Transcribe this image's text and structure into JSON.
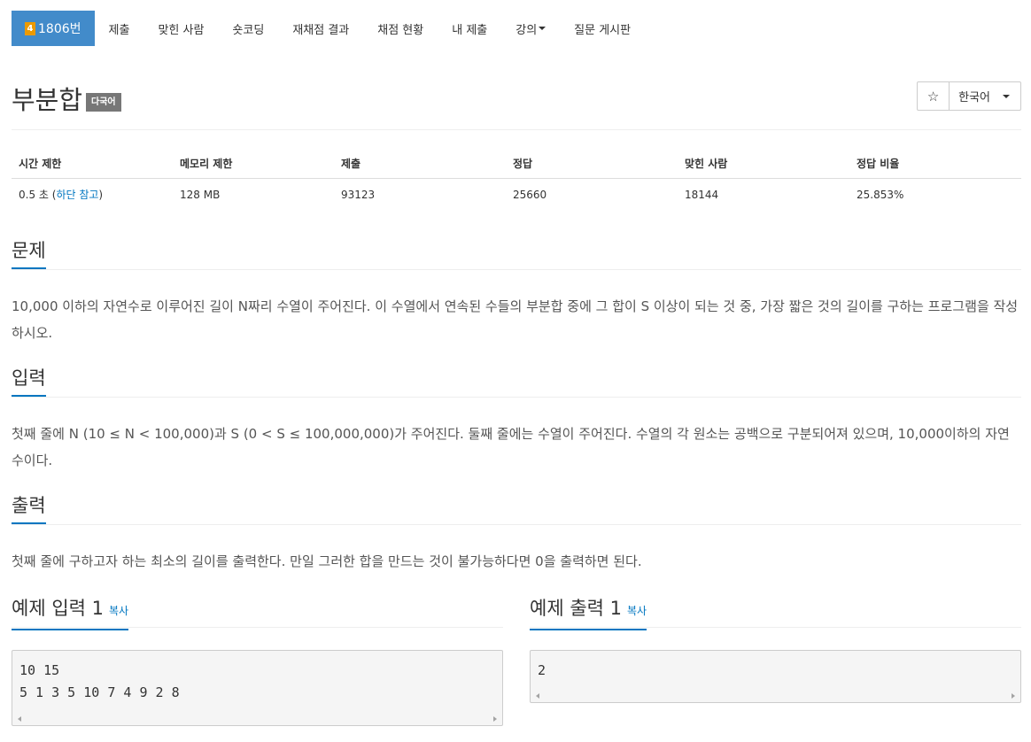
{
  "nav": {
    "tier_badge": "4",
    "problem_number": "1806번",
    "items": [
      "제출",
      "맞힌 사람",
      "숏코딩",
      "재채점 결과",
      "채점 현황",
      "내 제출",
      "강의",
      "질문 게시판"
    ]
  },
  "problem": {
    "title": "부분합",
    "label": "다국어",
    "star": "☆",
    "language": "한국어"
  },
  "info": {
    "headers": [
      "시간 제한",
      "메모리 제한",
      "제출",
      "정답",
      "맞힌 사람",
      "정답 비율"
    ],
    "time_value": "0.5 초 (",
    "time_link": "하단 참고",
    "time_close": ")",
    "memory": "128 MB",
    "submissions": "93123",
    "accepted": "25660",
    "solvers": "18144",
    "ratio": "25.853%"
  },
  "sections": {
    "description": {
      "title": "문제",
      "text": "10,000 이하의 자연수로 이루어진 길이 N짜리 수열이 주어진다. 이 수열에서 연속된 수들의 부분합 중에 그 합이 S 이상이 되는 것 중, 가장 짧은 것의 길이를 구하는 프로그램을 작성하시오."
    },
    "input": {
      "title": "입력",
      "text": "첫째 줄에 N (10 ≤ N < 100,000)과 S (0 < S ≤ 100,000,000)가 주어진다. 둘째 줄에는 수열이 주어진다. 수열의 각 원소는 공백으로 구분되어져 있으며, 10,000이하의 자연수이다."
    },
    "output": {
      "title": "출력",
      "text": "첫째 줄에 구하고자 하는 최소의 길이를 출력한다. 만일 그러한 합을 만드는 것이 불가능하다면 0을 출력하면 된다."
    }
  },
  "samples": {
    "input": {
      "title": "예제 입력 1",
      "copy": "복사",
      "content": "10 15\n5 1 3 5 10 7 4 9 2 8"
    },
    "output": {
      "title": "예제 출력 1",
      "copy": "복사",
      "content": "2"
    }
  },
  "colors": {
    "accent": "#428bca",
    "link": "#0076c0",
    "tier": "#ec9a00"
  }
}
